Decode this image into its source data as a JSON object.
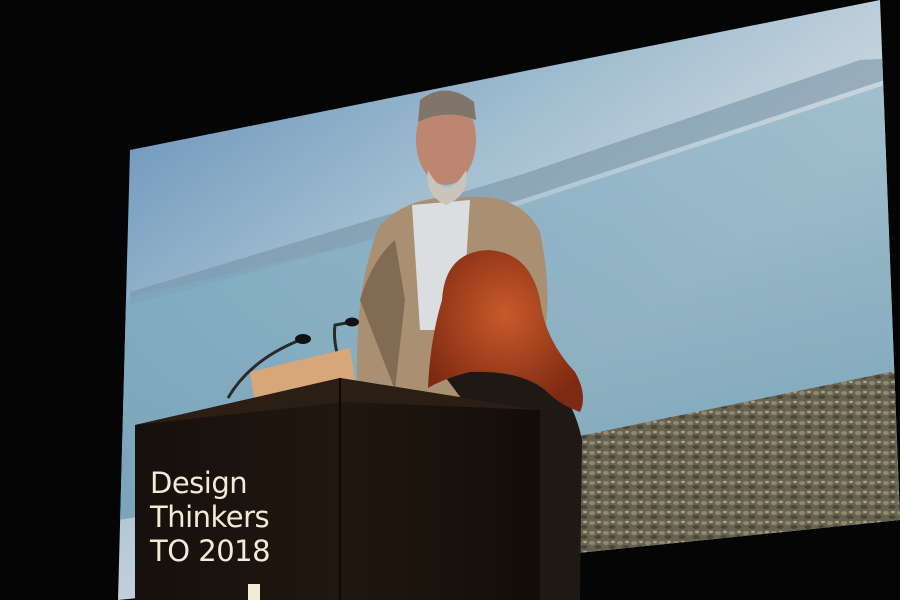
{
  "scene": {
    "subject": "Speaker at a podium in front of a large projection screen showing a bearded man standing on a rocky shoreline"
  },
  "podium": {
    "sign_lines": [
      "Design",
      "Thinkers",
      "TO 2018"
    ]
  },
  "colors": {
    "background": "#050505",
    "podium": "#1a1410",
    "sign_text": "#f3ead8",
    "hair": "#b4411e",
    "sky": "#8fb6cf"
  }
}
